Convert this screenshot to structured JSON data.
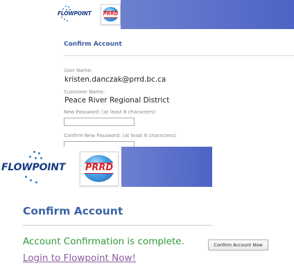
{
  "branding": {
    "flowpoint_word": "FLOWPOINT",
    "prrd_word": "PRRD",
    "header_color": "#5a6fc9"
  },
  "back_page": {
    "title": "Confirm Account",
    "username_label": "User Name:",
    "username_value": "kristen.danczak@prrd.bc.ca",
    "customer_label": "Customer Name:",
    "customer_value": "Peace River Regional District",
    "new_password_label": "New Password: (at least 8 characters)",
    "new_password_value": "",
    "confirm_password_label": "Confirm New Password: (at least 8 characters)",
    "confirm_password_value": "",
    "confirm_button_label": "Confirm Account Now"
  },
  "front_page": {
    "title": "Confirm Account",
    "message": "Account Confirmation is complete.",
    "message_color": "#2e9a38",
    "login_link": "Login to Flowpoint Now!"
  }
}
